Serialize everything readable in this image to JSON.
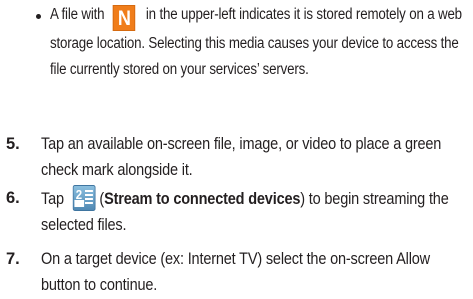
{
  "bullet": {
    "text_before": "A file with",
    "icon_letter": "N",
    "text_after": "in the upper-left indicates it is stored remotely on a web storage location. Selecting this media causes your device to access the file currently stored on your services’ servers."
  },
  "steps": [
    {
      "number": "5.",
      "text": "Tap an available on-screen file, image, or video to place a green check mark alongside it."
    },
    {
      "number": "6.",
      "text_before": "Tap",
      "icon_name": "stream-to-connected-devices-icon",
      "icon_digit": "2",
      "paren_open": "(",
      "bold_text": "Stream to connected devices",
      "paren_close": ")",
      "text_after": "to begin streaming the selected files."
    },
    {
      "number": "7.",
      "text": "On a target device (ex: Internet TV) select the on-screen Allow button to continue."
    }
  ],
  "colors": {
    "text": "#231f20",
    "remote_icon": "#f07d1a",
    "stream_icon": "#6aa1c7"
  }
}
